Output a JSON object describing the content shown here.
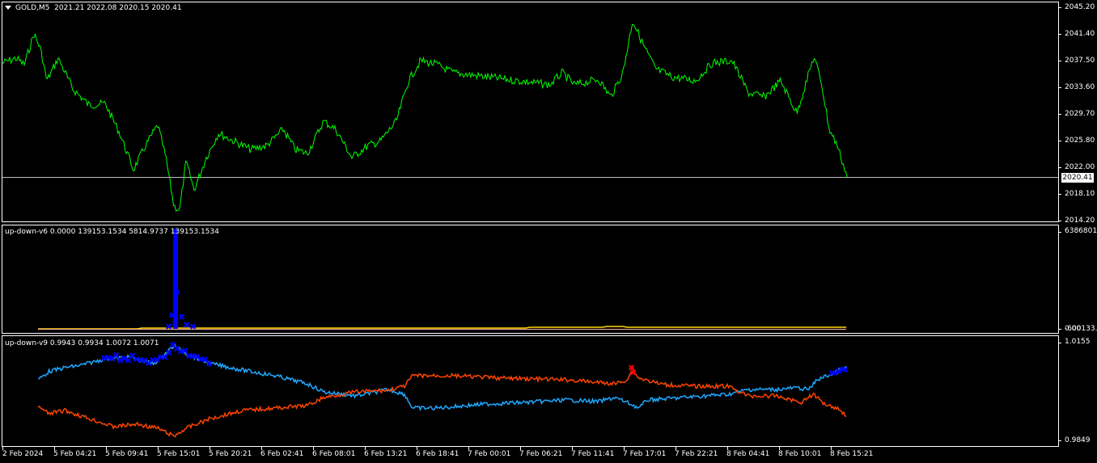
{
  "main_panel": {
    "symbol": "GOLD,M5",
    "ohlc": "2021.21 2022.08 2020.15 2020.41",
    "current_price": "2020.41",
    "y_ticks": [
      "2045.20",
      "2041.40",
      "2037.50",
      "2033.60",
      "2029.70",
      "2025.80",
      "2022.00",
      "2018.10",
      "2014.20"
    ],
    "price_color": "#00ff00"
  },
  "indicator_v6": {
    "title": "up-down-v6 0.0000 139153.1534 5814.9737 139153.1534",
    "y_top": "6386801.2",
    "y_bottom": "-600133.3",
    "y_bottom_overlap": "0.00",
    "colors": {
      "histogram": "#0000ff",
      "signal": "#ffd700",
      "base": "#ff7f7f"
    }
  },
  "indicator_v9": {
    "title": "up-down-v9 0.9943 0.9934 1.0072 1.0071",
    "y_top": "1.0155",
    "y_bottom": "0.9849",
    "colors": {
      "up_line": "#1fa8ff",
      "down_line": "#ff4500",
      "up_marker": "#0000ff",
      "down_marker": "#ff0000"
    }
  },
  "time_axis": [
    "2 Feb 2024",
    "5 Feb 04:21",
    "5 Feb 09:41",
    "5 Feb 15:01",
    "5 Feb 20:21",
    "6 Feb 02:41",
    "6 Feb 08:01",
    "6 Feb 13:21",
    "6 Feb 18:41",
    "7 Feb 00:01",
    "7 Feb 06:21",
    "7 Feb 11:41",
    "7 Feb 17:01",
    "7 Feb 22:21",
    "8 Feb 04:41",
    "8 Feb 10:01",
    "8 Feb 15:21"
  ]
}
